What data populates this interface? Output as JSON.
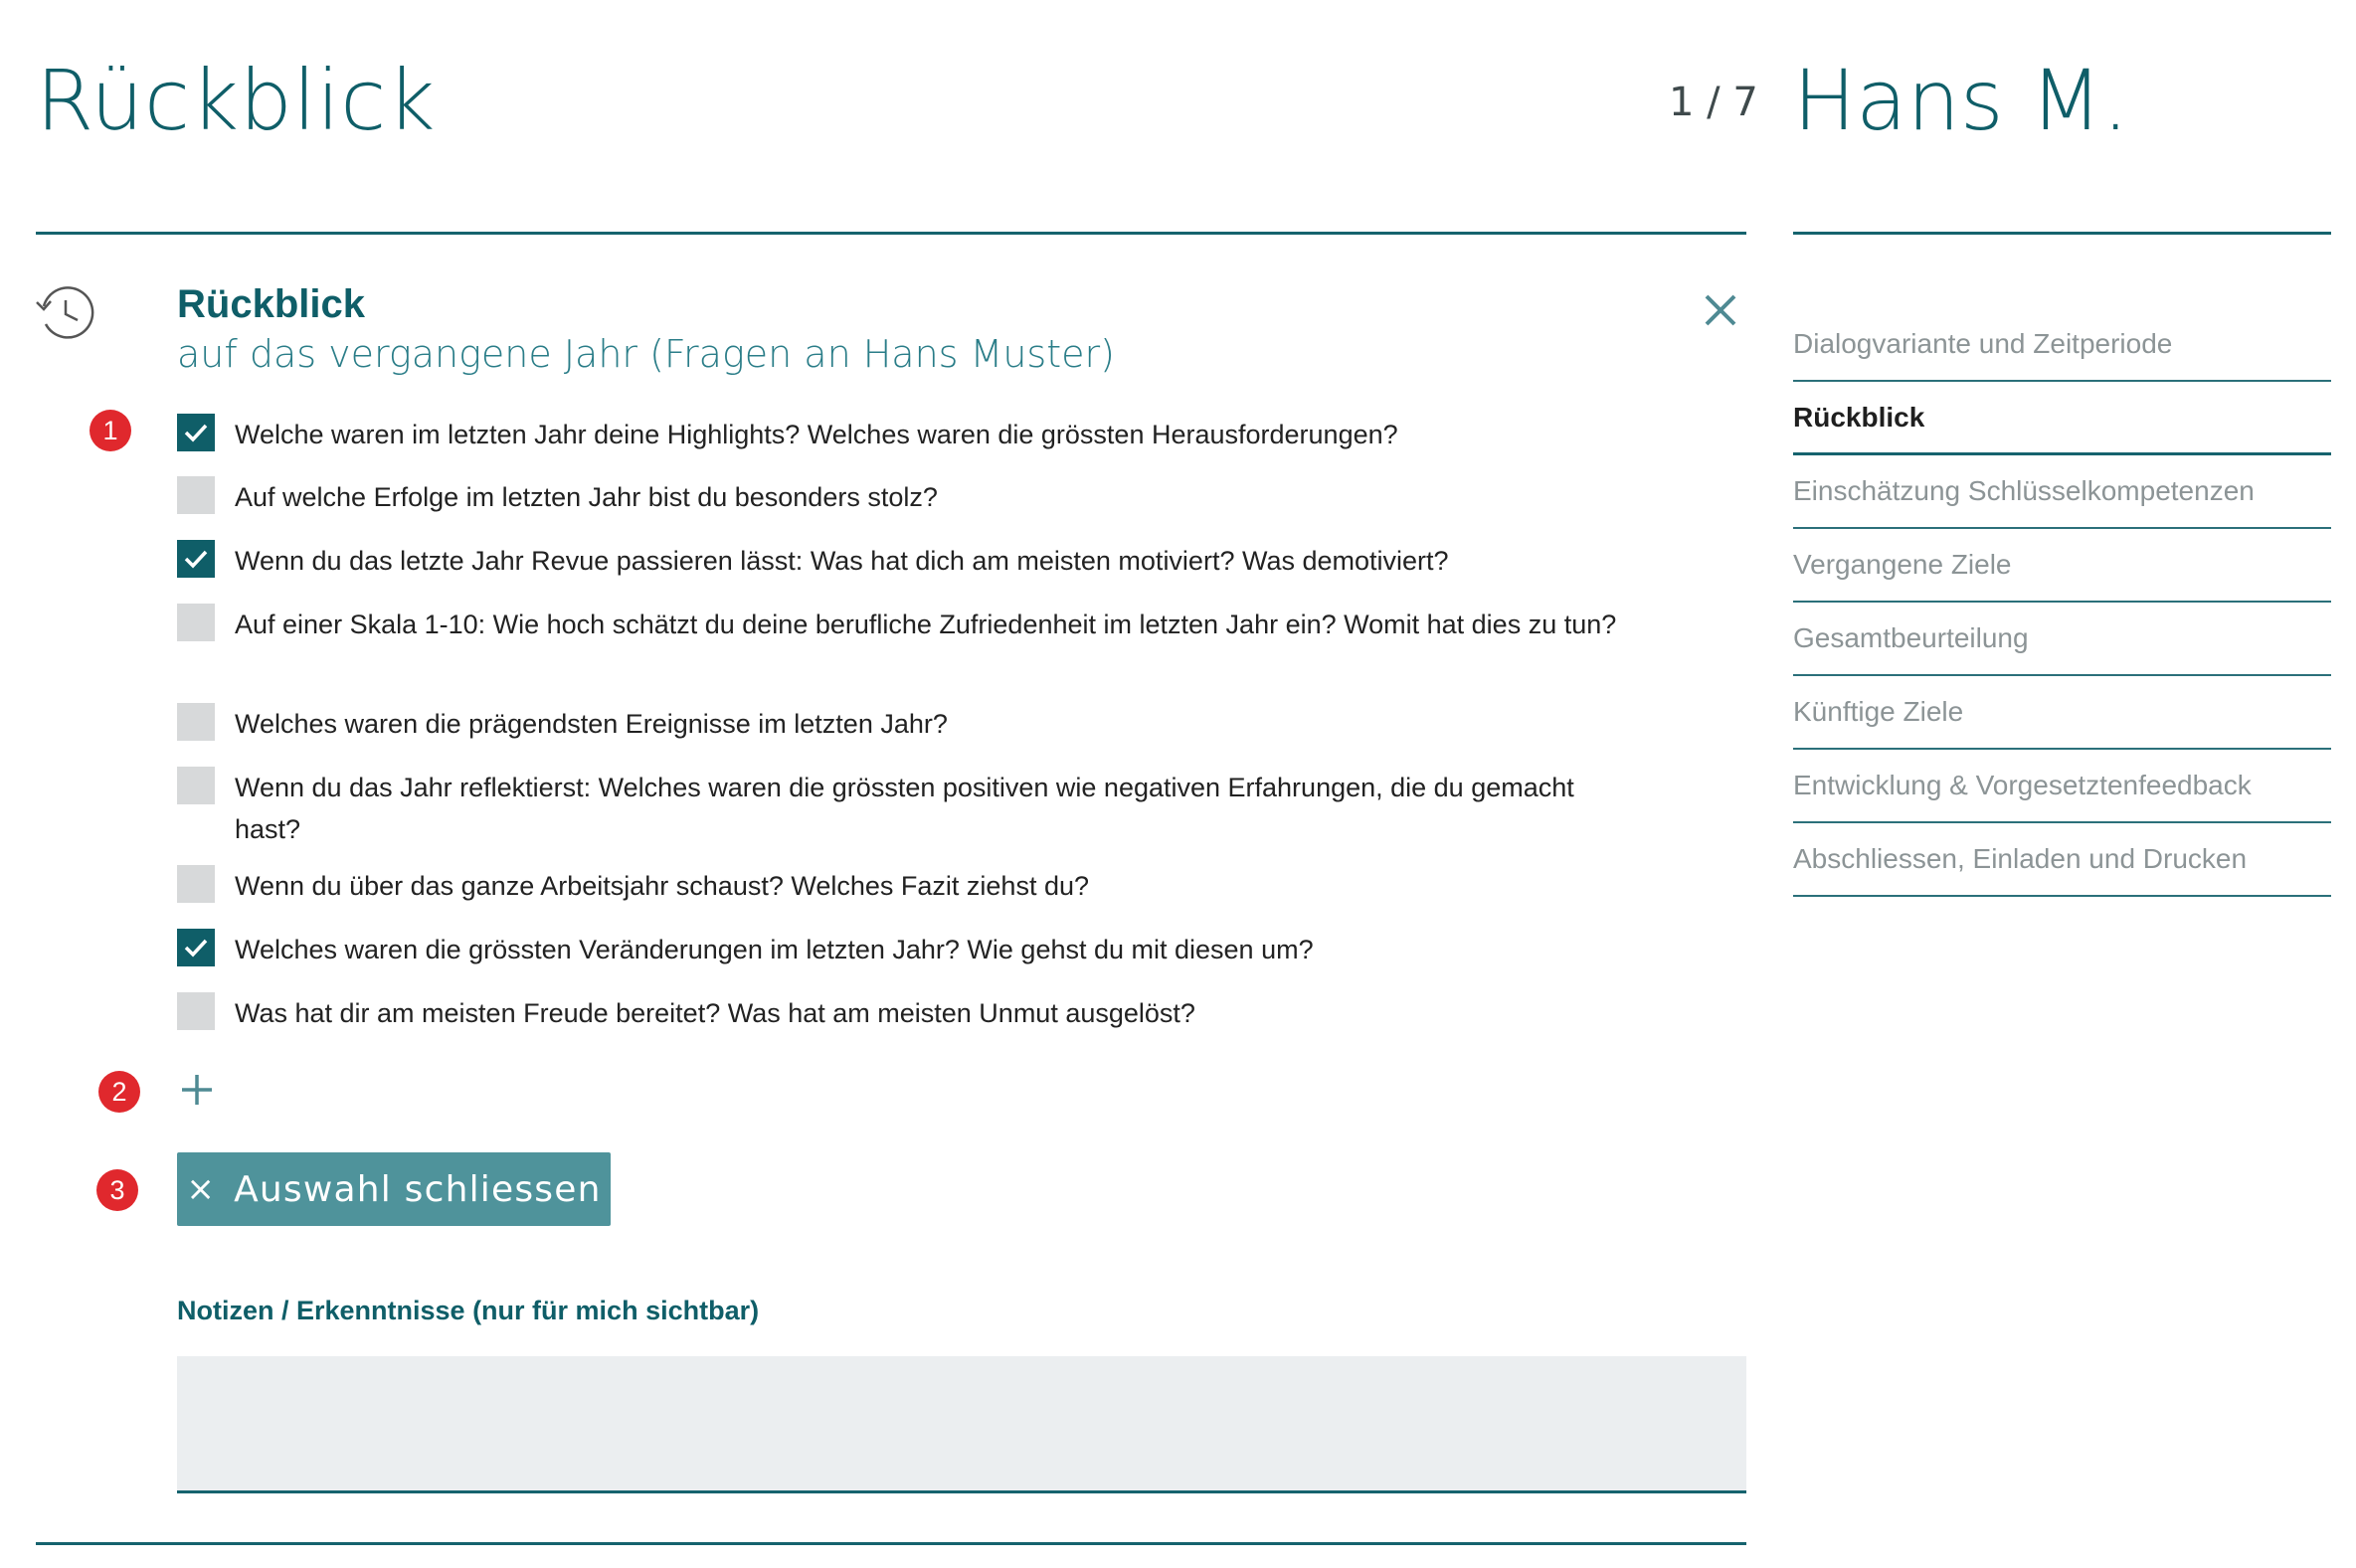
{
  "header": {
    "title": "Rückblick",
    "counter": "1 / 7",
    "person_name": "Hans M."
  },
  "section": {
    "heading": "Rückblick",
    "subheading": "auf das vergangene Jahr (Fragen an Hans Muster)",
    "icon": "history-icon",
    "close_icon": "close-icon"
  },
  "markers": [
    "1",
    "2",
    "3"
  ],
  "questions": [
    {
      "text": "Welche waren im letzten Jahr deine Highlights? Welches waren die grössten Herausforderungen?",
      "checked": true
    },
    {
      "text": "Auf welche Erfolge im letzten Jahr bist du besonders stolz?",
      "checked": false
    },
    {
      "text": "Wenn du das letzte Jahr Revue passieren lässt: Was hat dich am meisten motiviert? Was demotiviert?",
      "checked": true
    },
    {
      "text": "Auf einer Skala 1-10: Wie hoch schätzt du deine berufliche Zufriedenheit im letzten Jahr ein? Womit hat dies zu tun?",
      "checked": false
    },
    {
      "text": "Welches waren die prägendsten Ereignisse im letzten Jahr?",
      "checked": false
    },
    {
      "text": "Wenn du das Jahr reflektierst: Welches waren die grössten positiven wie negativen Erfahrungen, die du gemacht hast?",
      "checked": false
    },
    {
      "text": "Wenn du über das ganze Arbeitsjahr schaust? Welches Fazit ziehst du?",
      "checked": false
    },
    {
      "text": "Welches waren die grössten Veränderungen im letzten Jahr? Wie gehst du mit diesen um?",
      "checked": true
    },
    {
      "text": "Was hat dir am meisten Freude bereitet? Was hat am meisten Unmut ausgelöst?",
      "checked": false
    }
  ],
  "add_icon": "plus-icon",
  "close_selection_button": {
    "icon": "×",
    "label": "Auswahl schliessen"
  },
  "notes": {
    "label": "Notizen / Erkenntnisse (nur für mich sichtbar)",
    "value": ""
  },
  "steps": [
    {
      "label": "Dialogvariante und Zeitperiode",
      "active": false
    },
    {
      "label": "Rückblick",
      "active": true
    },
    {
      "label": "Einschätzung Schlüsselkompetenzen",
      "active": false
    },
    {
      "label": "Vergangene Ziele",
      "active": false
    },
    {
      "label": "Gesamtbeurteilung",
      "active": false
    },
    {
      "label": "Künftige Ziele",
      "active": false
    },
    {
      "label": "Entwicklung & Vorgesetztenfeedback",
      "active": false
    },
    {
      "label": "Abschliessen, Einladen und Drucken",
      "active": false
    }
  ],
  "colors": {
    "brand": "#0f5e68",
    "button": "#4f939b",
    "marker": "#e0282d",
    "checkbox_unchecked": "#d7d9da",
    "notes_background": "#ebeef0"
  }
}
